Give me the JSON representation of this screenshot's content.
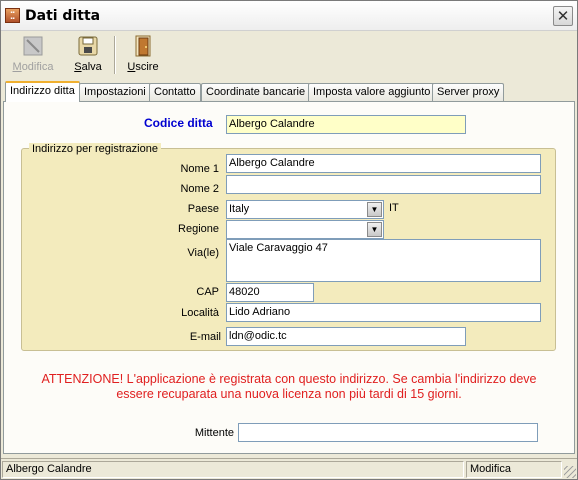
{
  "window": {
    "title": "Dati ditta",
    "app_icon": "app-icon",
    "close_glyph": "✕"
  },
  "toolbar": {
    "modifica": {
      "label": "Modifica",
      "mnemonic": "M",
      "rest": "odifica",
      "icon": "pencil-icon",
      "enabled": false
    },
    "salva": {
      "label": "Salva",
      "mnemonic": "S",
      "rest": "alva",
      "icon": "floppy-disk-icon"
    },
    "uscire": {
      "label": "Uscire",
      "mnemonic": "U",
      "rest": "scire",
      "icon": "exit-door-icon"
    }
  },
  "tabs": [
    {
      "label": "Indirizzo ditta",
      "active": true
    },
    {
      "label": "Impostazioni"
    },
    {
      "label": "Contatto"
    },
    {
      "label": "Coordinate bancarie"
    },
    {
      "label": "Imposta valore aggiunto"
    },
    {
      "label": "Server proxy"
    }
  ],
  "form": {
    "codice_ditta": {
      "label": "Codice ditta",
      "value": "Albergo Calandre"
    },
    "group_title": "Indirizzo per registrazione",
    "nome1": {
      "label": "Nome 1",
      "value": "Albergo Calandre"
    },
    "nome2": {
      "label": "Nome 2",
      "value": ""
    },
    "paese": {
      "label": "Paese",
      "value": "Italy",
      "code": "IT"
    },
    "regione": {
      "label": "Regione",
      "value": ""
    },
    "via": {
      "label": "Via(le)",
      "value": "Viale Caravaggio 47"
    },
    "cap": {
      "label": "CAP",
      "value": "48020"
    },
    "localita": {
      "label": "Località",
      "value": "Lido Adriano"
    },
    "email": {
      "label": "E-mail",
      "value": "ldn@odic.tc"
    },
    "mittente": {
      "label": "Mittente",
      "value": ""
    }
  },
  "warning": {
    "line1": "ATTENZIONE! L'applicazione è registrata con questo indirizzo. Se cambia l'indirizzo deve",
    "line2": "essere recuparata una nuova licenza non più tardi di 15 giorni."
  },
  "status": {
    "left": "Albergo Calandre",
    "mode": "Modifica"
  },
  "colors": {
    "accent_blue": "#0000d0",
    "warning_red": "#e02020",
    "group_bg": "#f3ebbd",
    "input_highlight": "#ffffc8"
  }
}
